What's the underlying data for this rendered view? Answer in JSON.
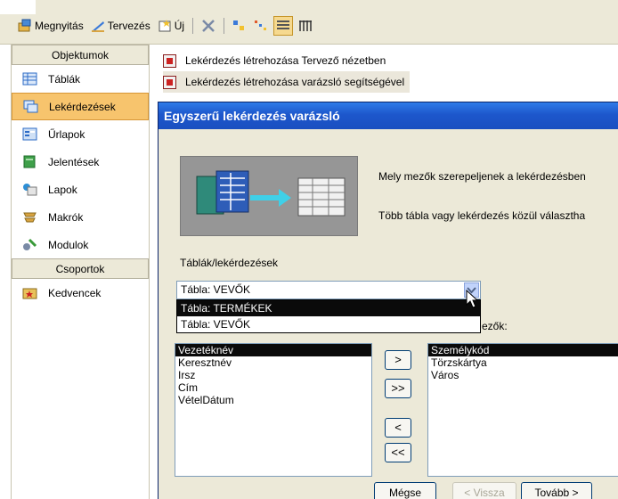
{
  "toolbar": {
    "open_label": "Megnyitás",
    "design_label": "Tervezés",
    "new_label": "Új"
  },
  "sidebar": {
    "objects_header": "Objektumok",
    "items": [
      {
        "label": "Táblák"
      },
      {
        "label": "Lekérdezések"
      },
      {
        "label": "Űrlapok"
      },
      {
        "label": "Jelentések"
      },
      {
        "label": "Lapok"
      },
      {
        "label": "Makrók"
      },
      {
        "label": "Modulok"
      }
    ],
    "groups_header": "Csoportok",
    "groups": [
      {
        "label": "Kedvencek"
      }
    ]
  },
  "query_list": [
    {
      "label": "Lekérdezés létrehozása Tervező nézetben"
    },
    {
      "label": "Lekérdezés létrehozása varázsló segítségével"
    }
  ],
  "dialog": {
    "title": "Egyszerű lekérdezés varázsló",
    "question1": "Mely mezők szerepeljenek a lekérdezésben",
    "question2": "Több tábla vagy lekérdezés közül választha",
    "tables_label": "Táblák/lekérdezések",
    "combo_value": "Tábla: VEVŐK",
    "dropdown_options": [
      "Tábla: TERMÉKEK",
      "Tábla: VEVŐK"
    ],
    "selected_fields_label": "ezők:",
    "available_fields": [
      "Vezetéknév",
      "Keresztnév",
      "Irsz",
      "Cím",
      "VételDátum"
    ],
    "selected_fields": [
      "Személykód",
      "Törzskártya",
      "Város"
    ],
    "move_buttons": {
      "add_one": ">",
      "add_all": ">>",
      "remove_one": "<",
      "remove_all": "<<"
    },
    "cancel_label": "Mégse",
    "back_label": "< Vissza",
    "next_label": "Tovább >"
  },
  "colors": {
    "accent_selected": "#f7c46d",
    "title_bar": "#1d57cc",
    "dialog_bg": "#ece9d8"
  }
}
